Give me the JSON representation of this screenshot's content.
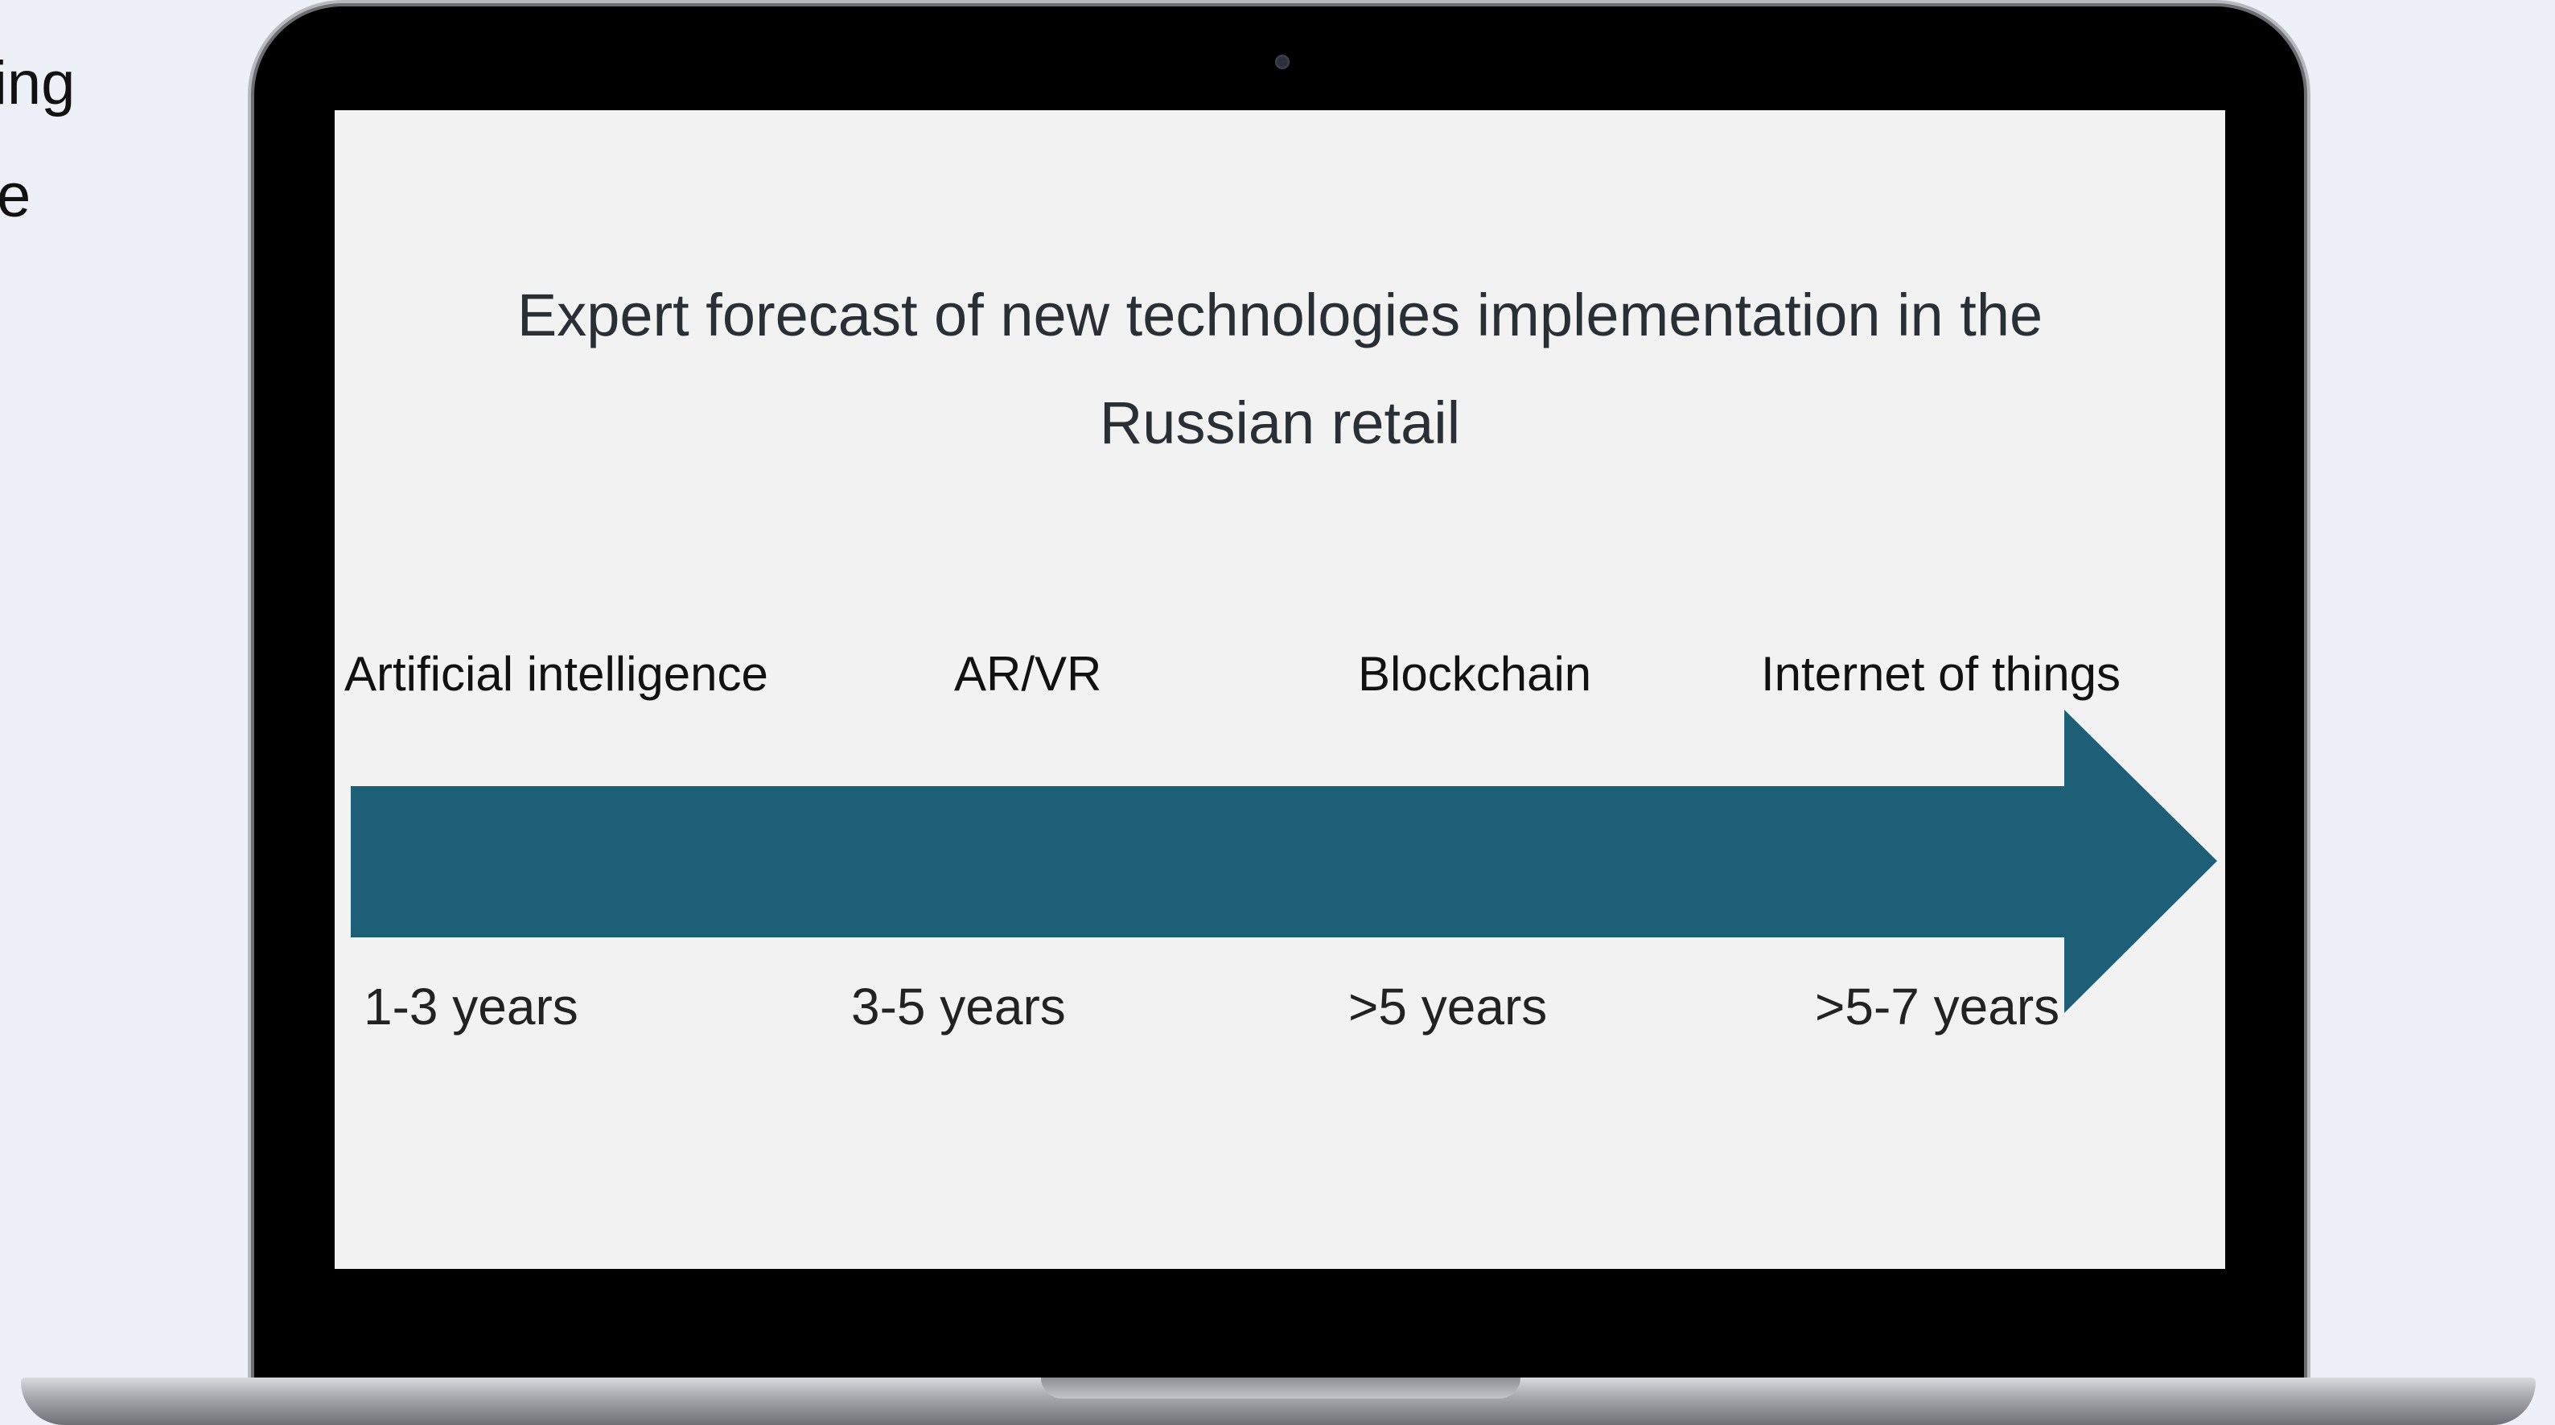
{
  "background_text": {
    "line1": "ing",
    "line2": "e"
  },
  "slide": {
    "title_line1": "Expert forecast of new technologies implementation in the",
    "title_line2": "Russian retail",
    "technologies": [
      "Artificial intelligence",
      "AR/VR",
      "Blockchain",
      "Internet of things"
    ],
    "periods": [
      "1-3 years",
      "3-5 years",
      ">5 years",
      ">5-7 years"
    ]
  },
  "colors": {
    "arrow": "#1e5f78",
    "screen_background": "#f2f2f2",
    "page_background": "#eef0f7"
  }
}
